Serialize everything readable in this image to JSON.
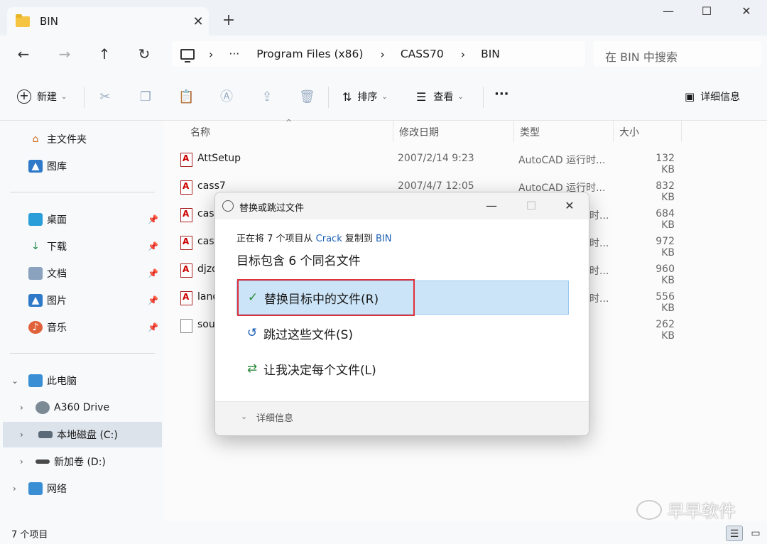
{
  "tab": {
    "title": "BIN",
    "close": "✕",
    "new": "+"
  },
  "window_controls": {
    "minimize": "—",
    "maximize": "☐",
    "close": "✕"
  },
  "nav": {
    "back": "←",
    "forward": "→",
    "up": "↑",
    "refresh": "↻"
  },
  "address": {
    "more": "···",
    "crumbs": [
      "Program Files (x86)",
      "CASS70",
      "BIN"
    ],
    "separator": "›"
  },
  "search": {
    "placeholder": "在 BIN 中搜索"
  },
  "toolbar": {
    "new_label": "新建",
    "sort_label": "排序",
    "view_label": "查看",
    "more": "···",
    "details_label": "详细信息"
  },
  "sidebar": {
    "quick": [
      {
        "label": "主文件夹",
        "icon": "home-icon"
      },
      {
        "label": "图库",
        "icon": "gallery-icon"
      }
    ],
    "pinned": [
      {
        "label": "桌面",
        "icon": "desktop-icon"
      },
      {
        "label": "下载",
        "icon": "download-icon"
      },
      {
        "label": "文档",
        "icon": "document-icon"
      },
      {
        "label": "图片",
        "icon": "pictures-icon"
      },
      {
        "label": "音乐",
        "icon": "music-icon"
      }
    ],
    "tree": [
      {
        "label": "此电脑",
        "icon": "pc-icon"
      },
      {
        "label": "A360 Drive",
        "icon": "cloud-drive-icon"
      },
      {
        "label": "本地磁盘 (C:)",
        "icon": "drive-icon"
      },
      {
        "label": "新加卷 (D:)",
        "icon": "drive-icon"
      },
      {
        "label": "网络",
        "icon": "network-icon"
      }
    ]
  },
  "columns": {
    "name": "名称",
    "date": "修改日期",
    "type": "类型",
    "size": "大小"
  },
  "files": [
    {
      "name": "AttSetup",
      "date": "2007/2/14 9:23",
      "type": "AutoCAD 运行时...",
      "size": "132 KB"
    },
    {
      "name": "cass7",
      "date": "2007/4/7 12:05",
      "type": "AutoCAD 运行时...",
      "size": "832 KB"
    },
    {
      "name": "cass",
      "date": "",
      "type": "",
      "size": "684 KB"
    },
    {
      "name": "cass",
      "date": "",
      "type": "",
      "size": "972 KB"
    },
    {
      "name": "djzd",
      "date": "",
      "type": "",
      "size": "960 KB"
    },
    {
      "name": "land",
      "date": "",
      "type": "",
      "size": "556 KB"
    },
    {
      "name": "sou",
      "date": "",
      "type": "",
      "size": "262 KB"
    }
  ],
  "file_row_tail": "时...",
  "status": {
    "count": "7 个项目"
  },
  "watermark": "早早软件",
  "dialog": {
    "title": "替换或跳过文件",
    "line1_prefix": "正在将 7 个项目从 ",
    "line1_source": "Crack",
    "line1_mid": " 复制到 ",
    "line1_target": "BIN",
    "line2": "目标包含 6 个同名文件",
    "options": [
      {
        "label": "替换目标中的文件(R)",
        "icon": "✓"
      },
      {
        "label": "跳过这些文件(S)",
        "icon": "↺"
      },
      {
        "label": "让我决定每个文件(L)",
        "icon": "⇄"
      }
    ],
    "details": "详细信息"
  },
  "colors": {
    "accent": "#1a5fb4",
    "highlight": "#cce4f7",
    "callout": "#e0303a"
  }
}
